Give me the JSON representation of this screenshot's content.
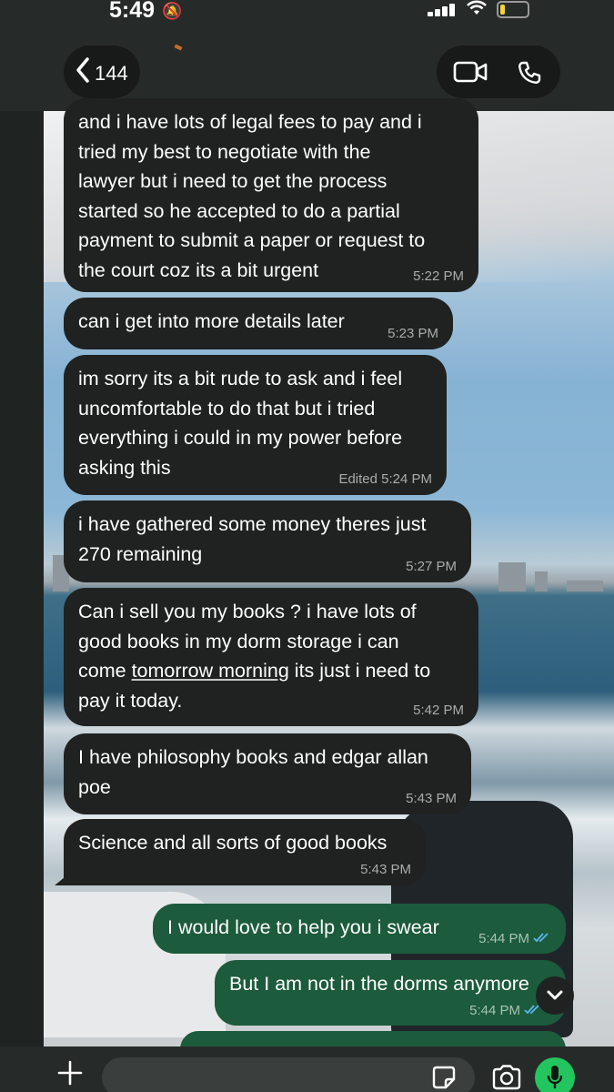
{
  "status_bar": {
    "time": "5:49"
  },
  "header": {
    "back_count": "144"
  },
  "messages": [
    {
      "dir": "in",
      "text": "and i have lots of legal fees to pay and i\ntried my best to negotiate with the\nlawyer but i need to get the process\nstarted so he accepted to do a partial\npayment to submit a paper or request to\nthe court coz its a bit urgent",
      "time": "5:22 PM"
    },
    {
      "dir": "in",
      "text": "can i get into more details later",
      "time": "5:23 PM"
    },
    {
      "dir": "in",
      "text": "im sorry its a bit rude to ask and i feel\nuncomfortable to do that but i tried\neverything i could in my power before\nasking this",
      "time": "Edited 5:24 PM"
    },
    {
      "dir": "in",
      "text": "i have gathered some money theres just\n270 remaining",
      "time": "5:27 PM"
    },
    {
      "dir": "in",
      "text_before": "Can i sell you my books ? i have lots of\ngood books in my dorm storage i can\ncome ",
      "text_link": "tomorrow morning",
      "text_after": " its just i need to\npay it today.",
      "time": "5:42 PM"
    },
    {
      "dir": "in",
      "text": "I have philosophy books and edgar allan\npoe",
      "time": "5:43 PM"
    },
    {
      "dir": "in",
      "text": "Science and all sorts of good books",
      "time": "5:43 PM"
    },
    {
      "dir": "out",
      "text": "I would love to help you i swear",
      "time": "5:44 PM"
    },
    {
      "dir": "out",
      "text": "But I am not in the dorms anymore",
      "time": "5:44 PM"
    }
  ],
  "icons": {
    "back": "chevron-left-icon",
    "video": "video-camera-icon",
    "call": "phone-icon",
    "attach": "plus-icon",
    "sticker": "sticker-icon",
    "camera": "camera-icon",
    "mic": "microphone-icon",
    "scroll": "chevron-down-icon",
    "read": "double-check-icon"
  },
  "colors": {
    "incoming_bubble": "#1f2221",
    "outgoing_bubble": "#1c5b3b",
    "read_ticks": "#5ab5f0",
    "mic_button": "#22c55e"
  }
}
